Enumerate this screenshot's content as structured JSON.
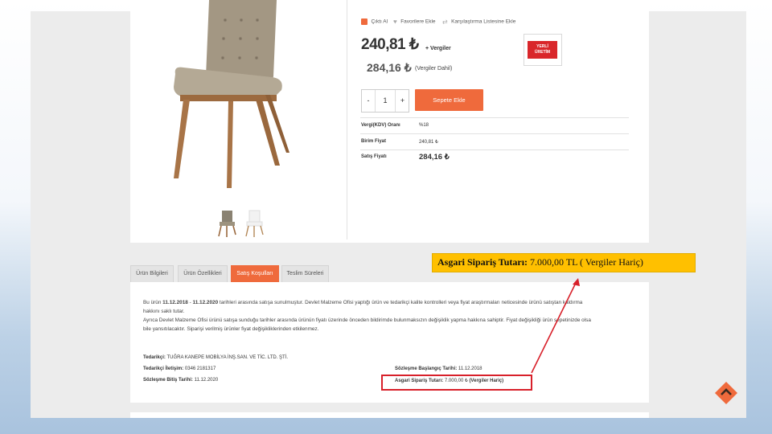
{
  "toolbar": {
    "print_label": "Çıktı Al",
    "favorites_label": "Favorilere Ekle",
    "compare_label": "Karşılaştırma Listesine Ekle"
  },
  "price": {
    "main": "240,81 ₺",
    "main_suffix": "+ Vergiler",
    "with_tax": "284,16 ₺",
    "with_tax_suffix": "(Vergiler Dahil)"
  },
  "badge": {
    "line1": "YERLİ",
    "line2": "ÜRETİM"
  },
  "quantity": {
    "minus": "-",
    "value": "1",
    "plus": "+"
  },
  "cart": {
    "button_label": "Sepete Ekle"
  },
  "info_table": [
    {
      "label": "Vergi(KDV) Oranı",
      "value": "%18"
    },
    {
      "label": "Birim Fiyat",
      "value": "240,81 ₺"
    },
    {
      "label": "Satış Fiyatı",
      "value": "284,16 ₺"
    }
  ],
  "tabs": [
    {
      "label": "Ürün Bilgileri"
    },
    {
      "label": "Ürün Özellikleri"
    },
    {
      "label": "Satış Koşulları"
    },
    {
      "label": "Teslim Süreleri"
    }
  ],
  "terms": {
    "p1_pre": "Bu ürün ",
    "p1_date1": "11.12.2018",
    "p1_mid": " - ",
    "p1_date2": "11.12.2020",
    "p1_post": " tarihleri arasında satışa sunulmuştur. Devlet Malzeme Ofisi yaptığı ürün ve tedarikçi kalite kontrolleri veya fiyat araştırmaları neticesinde ürünü satıştan kaldırma",
    "p1_line2": "hakkını saklı tutar.",
    "p2_line1": "Ayrıca Devlet Malzeme Ofisi ürünü satışa sunduğu tarihler arasında ürünün fiyatı üzerinde önceden bildirimde bulunmaksızın değişiklik yapma hakkına sahiptir. Fiyat değişikliği ürün sepetinizde olsa",
    "p2_line2": "bile yansıtılacaktır. Siparişi verilmiş ürünler fiyat değişikliklerinden etkilenmez."
  },
  "supplier": {
    "supplier_label": "Tedarikçi:",
    "supplier_value": "TUĞRA KANEPE MOBİLYA İNŞ.SAN. VE TİC. LTD. ŞTİ.",
    "contact_label": "Tedarikçi İletişim:",
    "contact_value": "0346 2181317",
    "end_label": "Sözleşme Bitiş Tarihi:",
    "end_value": "11.12.2020",
    "start_label": "Sözleşme Başlangıç Tarihi:",
    "start_value": "11.12.2018",
    "min_label": "Asgari Sipariş Tutarı:",
    "min_value": "7.000,00 ₺",
    "min_note": "(Vergiler Hariç)"
  },
  "callout": {
    "label": "Asgari Sipariş Tutarı:",
    "value": "7.000,00 TL ( Vergiler Hariç)"
  },
  "colors": {
    "accent": "#ef6a3c",
    "callout_bg": "#ffc000",
    "highlight_red": "#d8202a"
  }
}
